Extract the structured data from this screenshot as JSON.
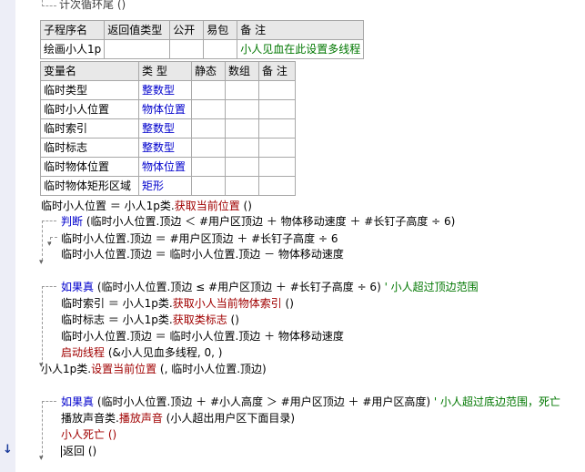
{
  "top_line": "计次循环尾 ()",
  "sub_table": {
    "headers": [
      "子程序名",
      "返回值类型",
      "公开",
      "易包",
      "备 注"
    ],
    "row": [
      "绘画小人1p",
      "",
      "",
      "",
      "小人见血在此设置多线程"
    ]
  },
  "var_table": {
    "headers": [
      "变量名",
      "类 型",
      "静态",
      "数组",
      "备 注"
    ],
    "rows": [
      [
        "临时类型",
        "整数型"
      ],
      [
        "临时小人位置",
        "物体位置"
      ],
      [
        "临时索引",
        "整数型"
      ],
      [
        "临时标志",
        "整数型"
      ],
      [
        "临时物体位置",
        "物体位置"
      ],
      [
        "临时物体矩形区域",
        "矩形"
      ]
    ]
  },
  "code": {
    "l1_a": "临时小人位置 ＝ 小人1p类.",
    "l1_b": "获取当前位置",
    "l1_c": " ()",
    "l2_a": "判断",
    "l2_b": " (临时小人位置.顶边 ＜ #用户区顶边 ＋ 物体移动速度 ＋ #长钉子高度 ÷ 6)",
    "l3": "临时小人位置.顶边 ＝ #用户区顶边 ＋ #长钉子高度 ÷ 6",
    "l4": "临时小人位置.顶边 ＝ 临时小人位置.顶边 － 物体移动速度",
    "l5_a": "如果真",
    "l5_b": " (临时小人位置.顶边 ≤ #用户区顶边 ＋ #长钉子高度 ÷ 6)",
    "l5_c": "  ' 小人超过顶边范围",
    "l6_a": "临时索引 ＝ 小人1p类.",
    "l6_b": "获取小人当前物体索引",
    "l6_c": " ()",
    "l7_a": "临时标志 ＝ 小人1p类.",
    "l7_b": "获取类标志",
    "l7_c": " ()",
    "l8": "临时小人位置.顶边 ＝ 临时小人位置.顶边 ＋ 物体移动速度",
    "l9_a": "启动线程",
    "l9_b": " (&小人见血多线程, 0, )",
    "l10_a": "小人1p类.",
    "l10_b": "设置当前位置",
    "l10_c": " (, 临时小人位置.顶边)",
    "l11_a": "如果真",
    "l11_b": " (临时小人位置.顶边 ＋ #小人高度 ＞ #用户区顶边 ＋ #用户区高度)",
    "l11_c": "  ' 小人超过底边范围，死亡",
    "l12_a": "播放声音类.",
    "l12_b": "播放声音",
    "l12_c": " (小人超出用户区下面目录)",
    "l13": "小人死亡 ()",
    "l14": "返回 ()"
  },
  "gutter_arrow": "↓"
}
